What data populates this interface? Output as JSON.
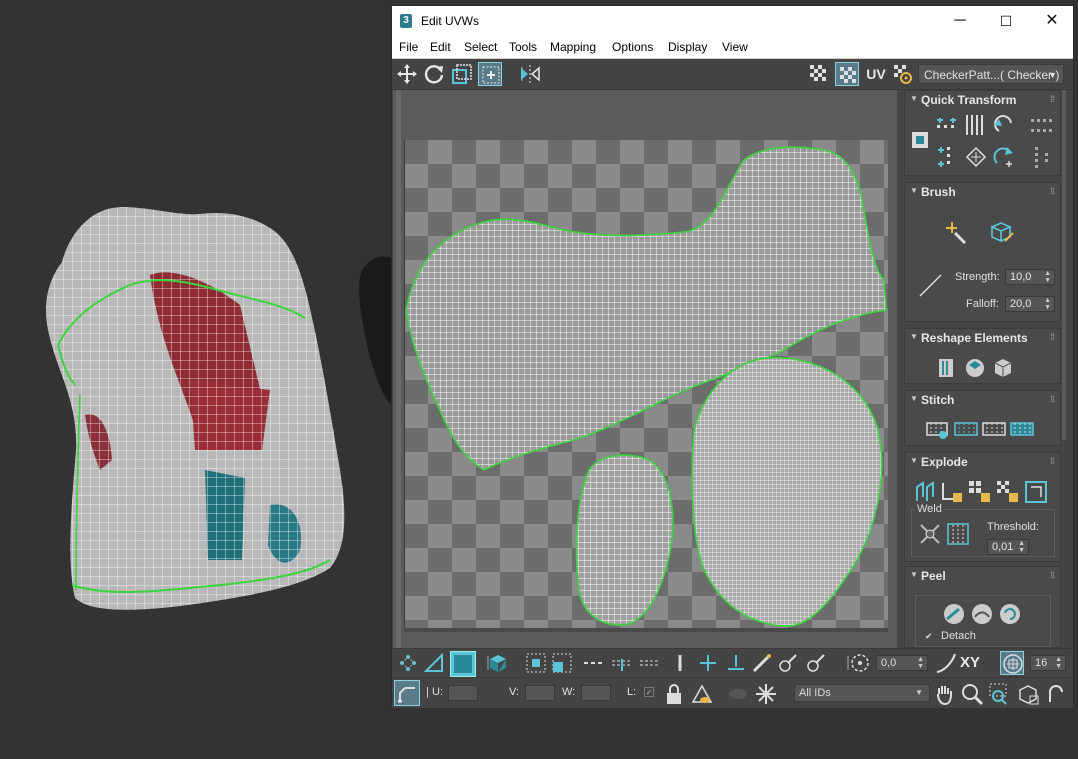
{
  "window": {
    "title": "Edit UVWs",
    "app_icon": "3",
    "controls": {
      "minimize": "─",
      "maximize": "☐",
      "close": "✕"
    }
  },
  "menu": [
    "File",
    "Edit",
    "Select",
    "Tools",
    "Mapping",
    "Options",
    "Display",
    "View"
  ],
  "toolbar": {
    "uv_label": "UV",
    "checker_dropdown": "CheckerPatt...( Checker )"
  },
  "panel": {
    "quick_transform": {
      "title": "Quick Transform"
    },
    "brush": {
      "title": "Brush",
      "strength_label": "Strength:",
      "strength_value": "10,0",
      "falloff_label": "Falloff:",
      "falloff_value": "20,0"
    },
    "reshape": {
      "title": "Reshape Elements"
    },
    "stitch": {
      "title": "Stitch"
    },
    "explode": {
      "title": "Explode",
      "weld_label": "Weld",
      "threshold_label": "Threshold:",
      "threshold_value": "0,01"
    },
    "peel": {
      "title": "Peel",
      "detach_label": "Detach",
      "detach_checked": "✔"
    }
  },
  "bottom_bar": {
    "angle_value": "0,0",
    "xy_label": "XY",
    "grid_value": "16",
    "u_label": "U:",
    "v_label": "V:",
    "w_label": "W:",
    "l_label": "L:",
    "ids_dropdown": "All IDs"
  },
  "colors": {
    "accent": "#5bc4d6",
    "seam_green": "#33cc33",
    "checker_light": "#8c8c8c",
    "checker_dark": "#6e6e6e"
  }
}
